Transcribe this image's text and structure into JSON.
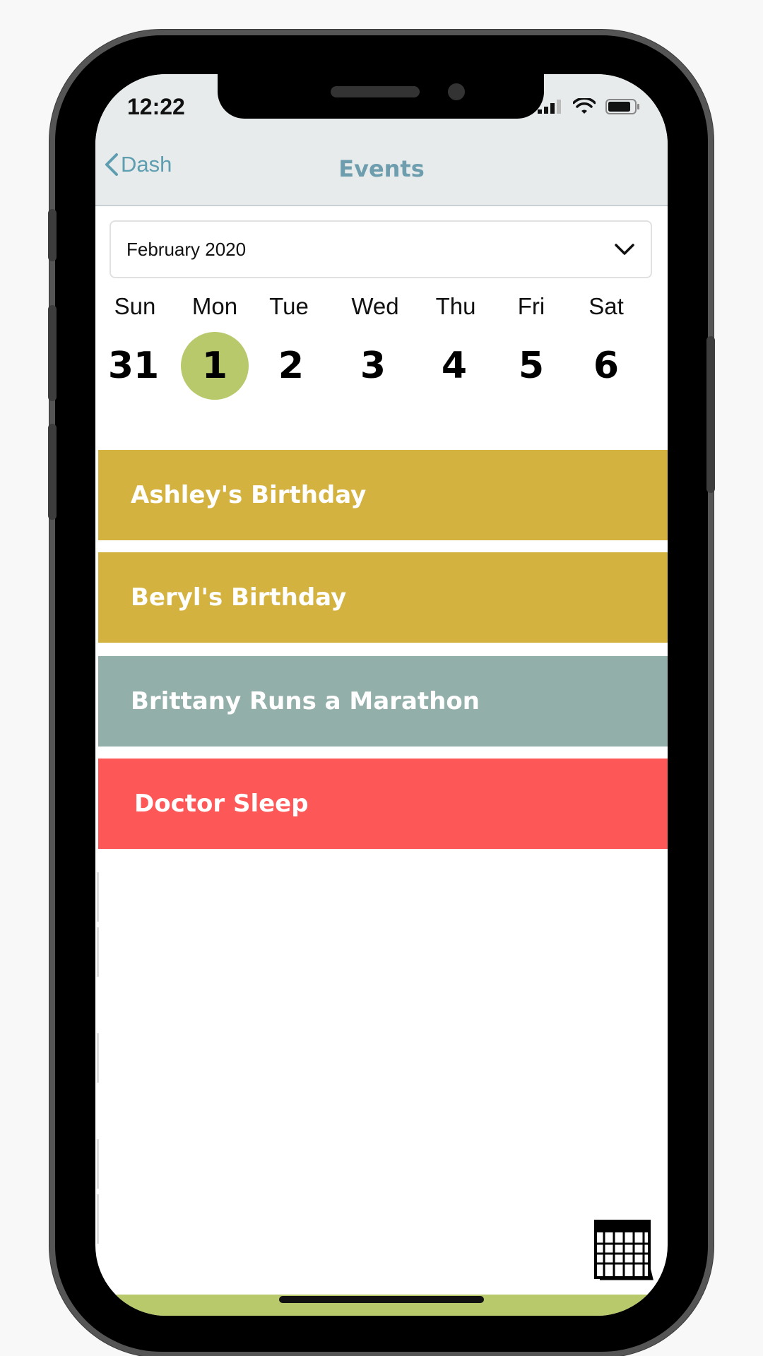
{
  "status_bar": {
    "time": "12:22"
  },
  "nav": {
    "back_label": "Dash",
    "title": "Events"
  },
  "month_picker": {
    "selected": "February 2020"
  },
  "week": {
    "days": [
      {
        "label": "Sun",
        "date": "31"
      },
      {
        "label": "Mon",
        "date": "1"
      },
      {
        "label": "Tue",
        "date": "2"
      },
      {
        "label": "Wed",
        "date": "3"
      },
      {
        "label": "Thu",
        "date": "4"
      },
      {
        "label": "Fri",
        "date": "5"
      },
      {
        "label": "Sat",
        "date": "6"
      }
    ],
    "selected_index": 1
  },
  "events": [
    {
      "title": "Ashley's Birthday",
      "color": "#d4b23f"
    },
    {
      "title": "Beryl's Birthday",
      "color": "#d4b23f"
    },
    {
      "title": "Brittany Runs a Marathon",
      "color": "#93afa9"
    },
    {
      "title": "Doctor Sleep",
      "color": "#fe5757"
    }
  ],
  "colors": {
    "accent": "#b7c96b",
    "header_bg": "#e7ebec",
    "nav_text": "#6e9eae"
  },
  "icons": {
    "back": "chevron-left-icon",
    "dropdown": "chevron-down-icon",
    "calendar": "calendar-icon"
  }
}
